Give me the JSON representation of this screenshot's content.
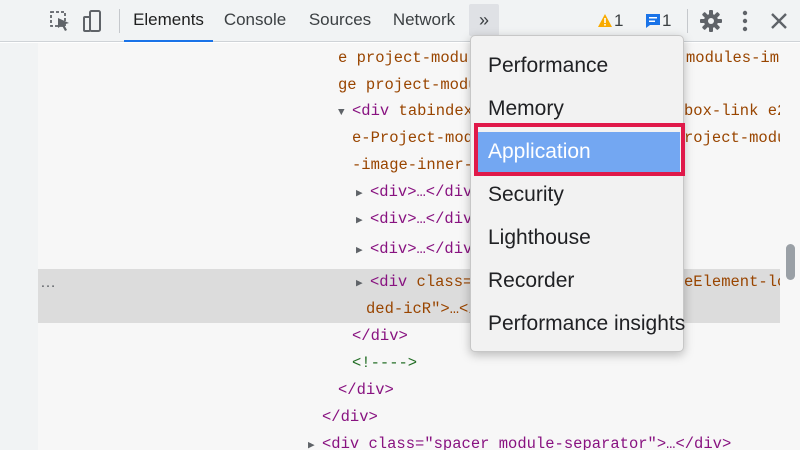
{
  "toolbar": {
    "tabs": [
      "Elements",
      "Console",
      "Sources",
      "Network"
    ],
    "active_tab": "Elements",
    "more_tabs_glyph": "»",
    "warnings_count": "1",
    "messages_count": "1",
    "icons": {
      "inspect": "inspect-element-icon",
      "device": "device-toolbar-icon",
      "warning": "warning-icon",
      "messages": "messages-icon",
      "settings": "gear-icon",
      "menu": "kebab-menu-icon",
      "close": "close-icon"
    },
    "accent_color": "#1a73e8"
  },
  "tree": {
    "lines": {
      "l1a": "e project-module",
      "l1b": "modules-ima",
      "l2a": "ge project-modul",
      "l3a_tag": "<div",
      "l3a_attr": " tabindex=",
      "l3b": "box-link e2",
      "l4a": "e-Project-modu",
      "l4b": "roject-module",
      "l5a": "-image-inner-w",
      "l6": "<div>…</div>",
      "l7": "<div>…</div>",
      "l8": "<div>…</div>",
      "l9a_tag": "<div",
      "l9a_attr": " class=\"",
      "l9b": "eElement-loa",
      "l10": "ded-icR\">…</",
      "l11": "</div>",
      "l12": "<!---->",
      "l13": "</div>",
      "l14": "</div>",
      "l15": "<div class=\"spacer module-separator\">…</div>",
      "ellipsis": "…"
    }
  },
  "menu": {
    "items": [
      "Performance",
      "Memory",
      "Application",
      "Security",
      "Lighthouse",
      "Recorder",
      "Performance insights"
    ],
    "selected": "Application",
    "highlight_color": "#e0194a"
  }
}
